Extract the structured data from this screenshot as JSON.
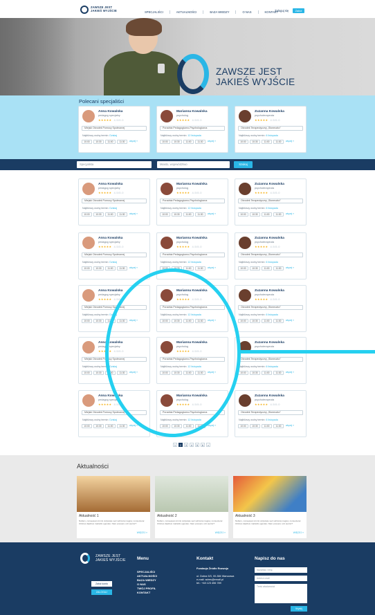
{
  "header": {
    "logo_line1": "ZAWSZE JEST",
    "logo_line2": "JAKIEŚ WYJŚCIE",
    "nav": [
      "SPECJALIŚCI",
      "AKTUALNOŚCI",
      "BAZA WIEDZY",
      "O NAS",
      "KONTAKT"
    ],
    "login": "Zaloguj się",
    "register": "Załóż konto"
  },
  "hero": {
    "line1": "ZAWSZE JEST",
    "line2": "JAKIEŚ WYJŚCIE"
  },
  "recommended": {
    "title": "Polecani specjaliści"
  },
  "search": {
    "specialist_placeholder": "Specjalista",
    "location_placeholder": "Miasto, województwo",
    "button": "Szukaj"
  },
  "cards": [
    {
      "name": "Anna Kowalska",
      "role": "pedagog specjalny",
      "stars": "★★★★★",
      "rating": "4.5/5.0",
      "place": "Miejski Ośrodek Pomocy Społecznej",
      "next_label": "Najbliższy wolny termin:",
      "next": "Dzisiaj",
      "slots": [
        "10:00",
        "10:30",
        "11:00",
        "11:30"
      ],
      "more": "więcej »",
      "avatar_color": "#d99a7c"
    },
    {
      "name": "Marianna Kowalska",
      "role": "psycholog",
      "stars": "★★★★★",
      "rating": "4.5/5.0",
      "place": "Poradnia Pedagogiczno-Psychologiczna",
      "next_label": "Najbliższy wolny termin:",
      "next": "12 listopada",
      "slots": [
        "10:00",
        "10:30",
        "11:00",
        "11:30"
      ],
      "more": "więcej »",
      "avatar_color": "#8a4a3a"
    },
    {
      "name": "Zuzanna Kowalska",
      "role": "psychoterapeuta",
      "stars": "★★★★★",
      "rating": "4.5/5.0",
      "place": "Ośrodek Terapeutyczny „Słoneczko”",
      "next_label": "Najbliższy wolny termin:",
      "next": "6 listopada",
      "slots": [
        "10:00",
        "10:30",
        "11:00",
        "11:30"
      ],
      "more": "więcej »",
      "avatar_color": "#6a3f2e"
    }
  ],
  "pagination": [
    "1",
    "2",
    "3",
    "4",
    "5",
    "6",
    "»"
  ],
  "news": {
    "title": "Aktualności",
    "items": [
      {
        "title": "Aktualność 1",
        "desc": "Nullam, consequat sit nisi vulputate sed vehicula magna; consectetur. Ultrices dapibus matisdis egestas. Nam posuere orci auctor?",
        "more": "WIĘCEJ »",
        "img": "#c9924e"
      },
      {
        "title": "Aktualność 2",
        "desc": "Nullam, consequat sit nisi vulputate sed vehicula magna; consectetur. Ultrices dapibus matisdis egestas. Nam posuere orci auctor?",
        "more": "WIĘCEJ »",
        "img": "#b9c7b0"
      },
      {
        "title": "Aktualność 3",
        "desc": "Nullam, consequat sit nisi vulputate sed vehicula magna; consectetur. Ultrices dapibus matisdis egestas. Nam posuere orci auctor?",
        "more": "WIĘCEJ »",
        "img": "#3f7fc6"
      }
    ]
  },
  "footer": {
    "logo_line1": "ZAWSZE JEST",
    "logo_line2": "JAKIEŚ WYJŚCIE",
    "btn_account": "Załóż konto",
    "btn_login": "ZALOGUJ",
    "menu_title": "Menu",
    "menu": [
      "SPECJALIŚCI",
      "AKTUALNOŚCI",
      "BAZA WIEDZY",
      "O NAS",
      "TWÓJ PROFIL",
      "KONTAKT"
    ],
    "contact_title": "Kontakt",
    "contact_org": "Fundacja Źródło Rozwoju",
    "contact_lines": [
      "ul. Dobra 5/3, 00-384 Warszawa",
      "e-mail: adres@email.pl",
      "tel.: +48 123 456 789"
    ],
    "write_title": "Napisz do nas",
    "name_placeholder": "Nazwisko i imię",
    "email_placeholder": "Adres e-mail",
    "message_placeholder": "Treść wiadomości",
    "send": "Wyślij"
  }
}
